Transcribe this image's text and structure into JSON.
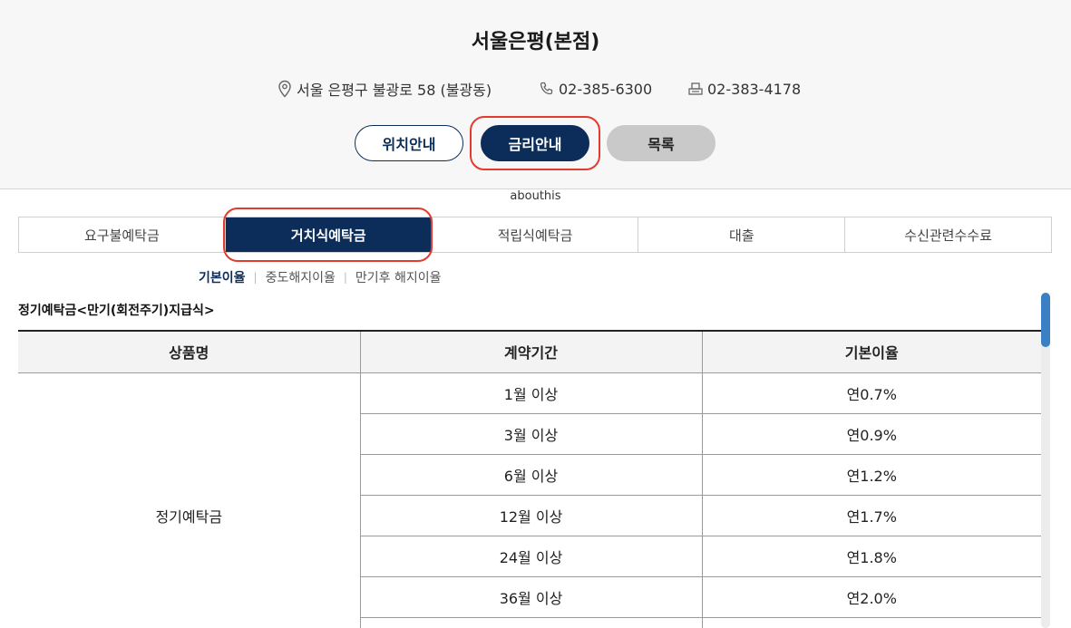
{
  "header": {
    "title": "서울은평(본점)",
    "address": "서울 은평구 불광로 58 (불광동)",
    "phone": "02-385-6300",
    "fax": "02-383-4178"
  },
  "buttons": {
    "location": "위치안내",
    "rates": "금리안내",
    "list": "목록"
  },
  "about_label": "abouthis",
  "tabs": [
    {
      "label": "요구불예탁금",
      "active": false
    },
    {
      "label": "거치식예탁금",
      "active": true
    },
    {
      "label": "적립식예탁금",
      "active": false
    },
    {
      "label": "대출",
      "active": false
    },
    {
      "label": "수신관련수수료",
      "active": false
    }
  ],
  "subtabs": [
    {
      "label": "기본이율",
      "active": true
    },
    {
      "label": "중도해지이율",
      "active": false
    },
    {
      "label": "만기후 해지이율",
      "active": false
    }
  ],
  "section_title": "정기예탁금<만기(회전주기)지급식>",
  "table": {
    "headers": [
      "상품명",
      "계약기간",
      "기본이율"
    ],
    "product_name": "정기예탁금",
    "rows": [
      {
        "term": "1월 이상",
        "rate": "연0.7%"
      },
      {
        "term": "3월 이상",
        "rate": "연0.9%"
      },
      {
        "term": "6월 이상",
        "rate": "연1.2%"
      },
      {
        "term": "12월 이상",
        "rate": "연1.7%"
      },
      {
        "term": "24월 이상",
        "rate": "연1.8%"
      },
      {
        "term": "36월 이상",
        "rate": "연2.0%"
      },
      {
        "term": "",
        "rate": ""
      }
    ]
  },
  "colors": {
    "primary": "#0c2d59",
    "highlight": "#e53a2e",
    "scroll_thumb": "#3b7fc4"
  }
}
